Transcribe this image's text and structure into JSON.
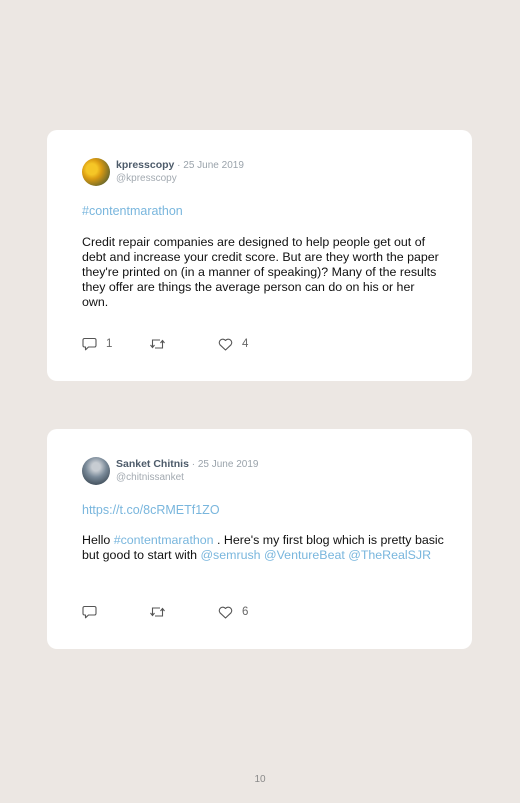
{
  "tweets": [
    {
      "display_name": "kpresscopy",
      "date": "25 June 2019",
      "handle": "@kpresscopy",
      "link": "#contentmarathon",
      "text": "Credit repair companies are designed to help people get out of debt and increase your credit score. But are they worth the paper they're printed on (in a manner of speaking)? Many of the results they offer are things the average person can do on his or her own.",
      "reply_count": "1",
      "retweet_count": "",
      "like_count": "4"
    },
    {
      "display_name": "Sanket Chitnis",
      "date": "25 June 2019",
      "handle": "@chitnissanket",
      "link": "https://t.co/8cRMETf1ZO",
      "text_prefix": "Hello ",
      "hashtag": "#contentmarathon",
      "text_middle": " . Here's my first blog which is pretty basic but good to start with ",
      "mention_1": "@semrush",
      "mention_2": "@VentureBeat",
      "mention_3": "@TheRealSJR",
      "reply_count": "",
      "retweet_count": "",
      "like_count": "6"
    }
  ],
  "separators": {
    "dot": " · "
  },
  "page_number": "10",
  "icons": {
    "reply": "reply-icon",
    "retweet": "retweet-icon",
    "like": "heart-icon"
  },
  "colors": {
    "background": "#ece7e3",
    "card": "#ffffff",
    "link": "#79b6dd",
    "display_name": "#4d5b6a",
    "muted": "#a3aab1"
  }
}
